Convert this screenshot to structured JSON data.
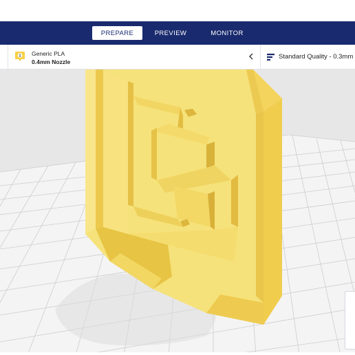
{
  "header": {
    "tabs": [
      {
        "label": "PREPARE",
        "active": true
      },
      {
        "label": "PREVIEW",
        "active": false
      },
      {
        "label": "MONITOR",
        "active": false
      }
    ],
    "background_color": "#192a6e"
  },
  "toolbar": {
    "material": {
      "badge_number": "1",
      "name": "Generic PLA",
      "nozzle": "0.4mm Nozzle",
      "badge_color": "#f7d046",
      "icon": "extruder-badge-icon"
    },
    "collapse_icon": "chevron-left-icon",
    "quality": {
      "label": "Standard Quality - 0.3mm",
      "icon": "print-settings-icon"
    }
  },
  "viewport": {
    "model_color": "#f6e27a",
    "grid_color": "#c9c9c9",
    "background_color": "#e7e7e7"
  }
}
